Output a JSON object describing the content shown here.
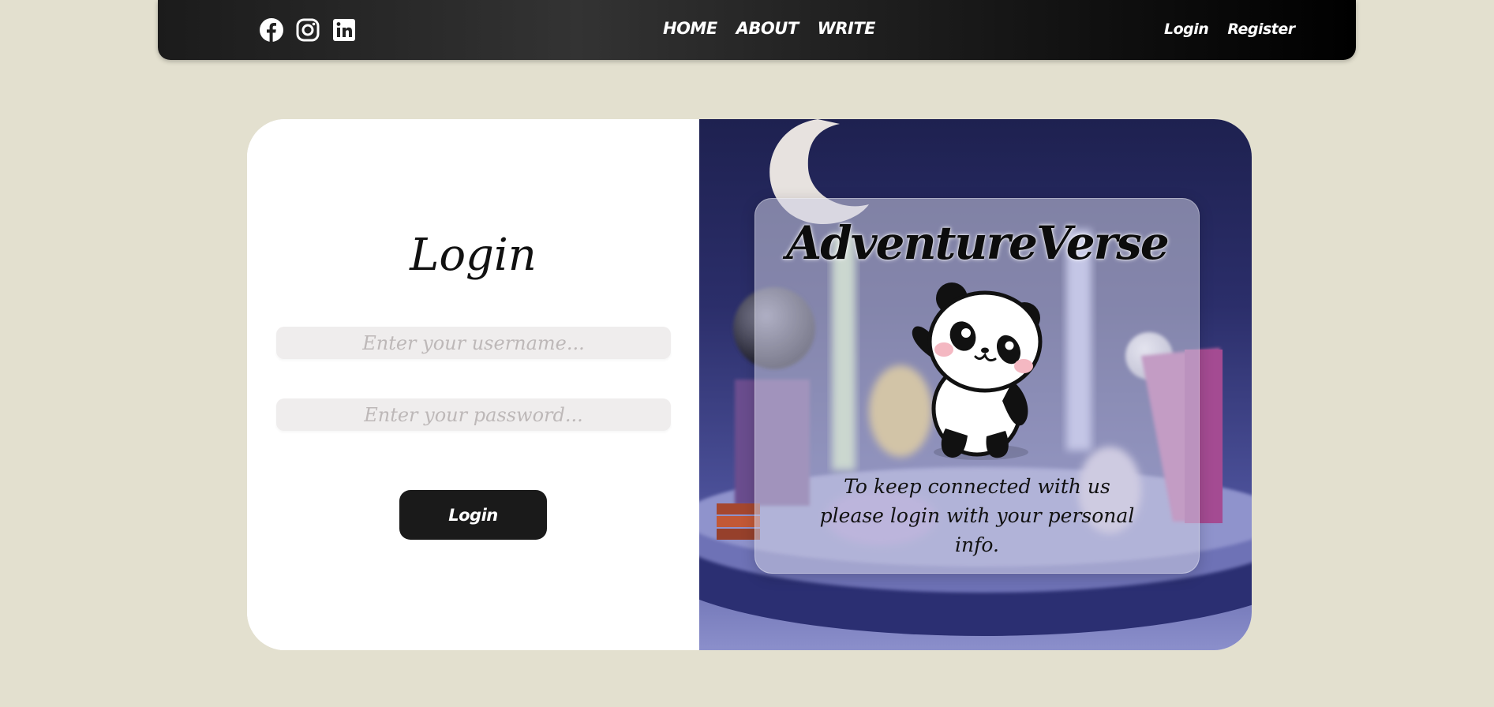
{
  "nav": {
    "social": [
      "facebook-icon",
      "instagram-icon",
      "linkedin-icon"
    ],
    "links": [
      "HOME",
      "ABOUT",
      "WRITE"
    ],
    "auth": [
      "Login",
      "Register"
    ]
  },
  "login": {
    "title": "Login",
    "username_placeholder": "Enter your username...",
    "password_placeholder": "Enter your password...",
    "button_label": "Login"
  },
  "promo": {
    "brand": "AdventureVerse",
    "tagline": "To keep connected with us please login with your personal info."
  },
  "colors": {
    "background": "#e3e0cf",
    "navbar": "#1e1e1e",
    "button": "#1a1a1a",
    "field": "#efeded",
    "scene_dark": "#1e2150",
    "scene_light": "#8b8fcb"
  }
}
